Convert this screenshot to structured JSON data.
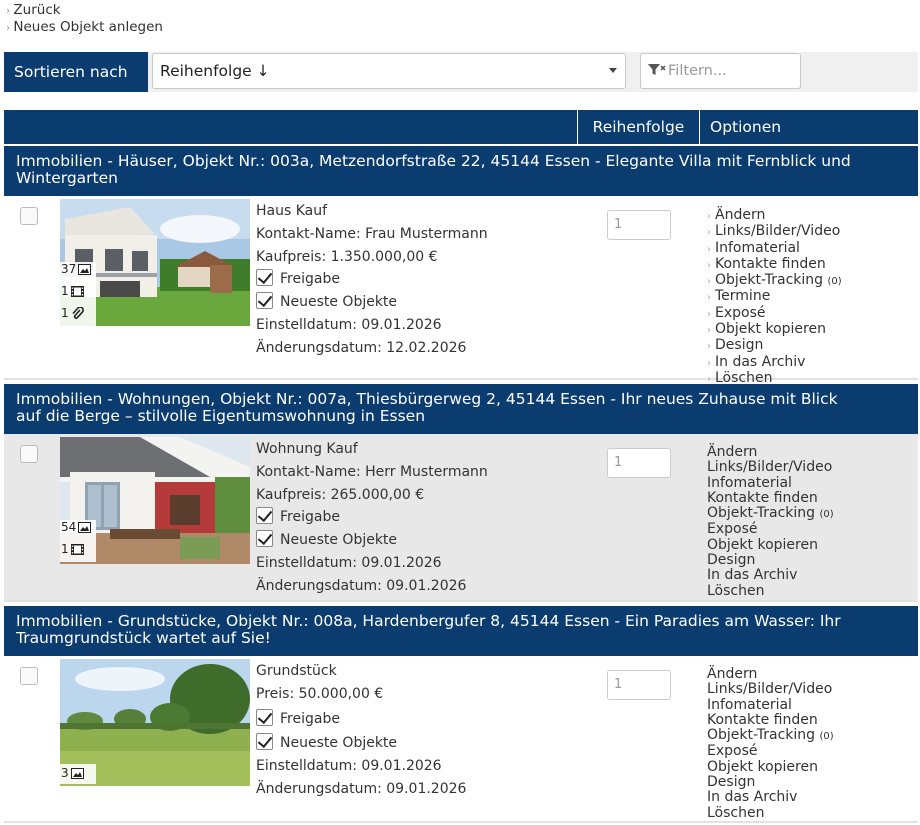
{
  "nav": {
    "back_label": "Zurück",
    "new_label": "Neues Objekt anlegen"
  },
  "sort": {
    "label": "Sortieren nach",
    "selected": "Reihenfolge ↓",
    "filter_placeholder": "Filtern..."
  },
  "table_header": {
    "order": "Reihenfolge",
    "options": "Optionen"
  },
  "options_labels": [
    "Ändern",
    "Links/Bilder/Video",
    "Infomaterial",
    "Kontakte finden",
    "Objekt-Tracking",
    "Termine",
    "Exposé",
    "Objekt kopieren",
    "Design",
    "In das Archiv",
    "Löschen"
  ],
  "listings": [
    {
      "title_line1": "Immobilien - Häuser, Objekt Nr.: 003a, Metzendorfstraße 22, 45144 Essen - Elegante Villa mit Fernblick und",
      "title_line2": "Wintergarten",
      "type": "Haus Kauf",
      "contact": "Kontakt-Name: Frau Mustermann",
      "price": "Kaufpreis: 1.350.000,00 €",
      "release": "Freigabe",
      "newest": "Neueste Objekte",
      "created": "Einstelldatum: 09.01.2026",
      "modified": "Änderungsdatum: 12.02.2026",
      "order_value": "1",
      "image_count": "37",
      "video_count": "1",
      "attachment_count": "1",
      "tracking_count": "(0)",
      "options": {
        "edit": "Ändern",
        "links": "Links/Bilder/Video",
        "info": "Infomaterial",
        "contacts": "Kontakte finden",
        "tracking": "Objekt-Tracking",
        "appointments": "Termine",
        "expose": "Exposé",
        "copy": "Objekt kopieren",
        "design": "Design",
        "archive": "In das Archiv",
        "delete": "Löschen"
      }
    },
    {
      "title_line1": "Immobilien - Wohnungen, Objekt Nr.: 007a, Thiesbürgerweg 2, 45144 Essen - Ihr neues Zuhause mit Blick",
      "title_line2": "auf die Berge – stilvolle Eigentumswohnung in Essen",
      "type": "Wohnung Kauf",
      "contact": "Kontakt-Name: Herr Mustermann",
      "price": "Kaufpreis: 265.000,00 €",
      "release": "Freigabe",
      "newest": "Neueste Objekte",
      "created": "Einstelldatum: 09.01.2026",
      "modified": "Änderungsdatum: 09.01.2026",
      "order_value": "1",
      "image_count": "54",
      "video_count": "1",
      "tracking_count": "(0)",
      "options": {
        "edit": "Ändern",
        "links": "Links/Bilder/Video",
        "info": "Infomaterial",
        "contacts": "Kontakte finden",
        "tracking": "Objekt-Tracking",
        "expose": "Exposé",
        "copy": "Objekt kopieren",
        "design": "Design",
        "archive": "In das Archiv",
        "delete": "Löschen"
      }
    },
    {
      "title_line1": "Immobilien - Grundstücke, Objekt Nr.: 008a, Hardenbergufer 8, 45144 Essen - Ein Paradies am Wasser: Ihr",
      "title_line2": "Traumgrundstück wartet auf Sie!",
      "type": "Grundstück",
      "price": "Preis: 50.000,00 €",
      "release": "Freigabe",
      "newest": "Neueste Objekte",
      "created": "Einstelldatum: 09.01.2026",
      "modified": "Änderungsdatum: 09.01.2026",
      "order_value": "1",
      "image_count": "3",
      "tracking_count": "(0)",
      "options": {
        "edit": "Ändern",
        "links": "Links/Bilder/Video",
        "info": "Infomaterial",
        "contacts": "Kontakte finden",
        "tracking": "Objekt-Tracking",
        "expose": "Exposé",
        "copy": "Objekt kopieren",
        "design": "Design",
        "archive": "In das Archiv",
        "delete": "Löschen"
      }
    }
  ],
  "colors": {
    "header_blue": "#0b3c70",
    "row_alt": "#e8e8e8"
  }
}
